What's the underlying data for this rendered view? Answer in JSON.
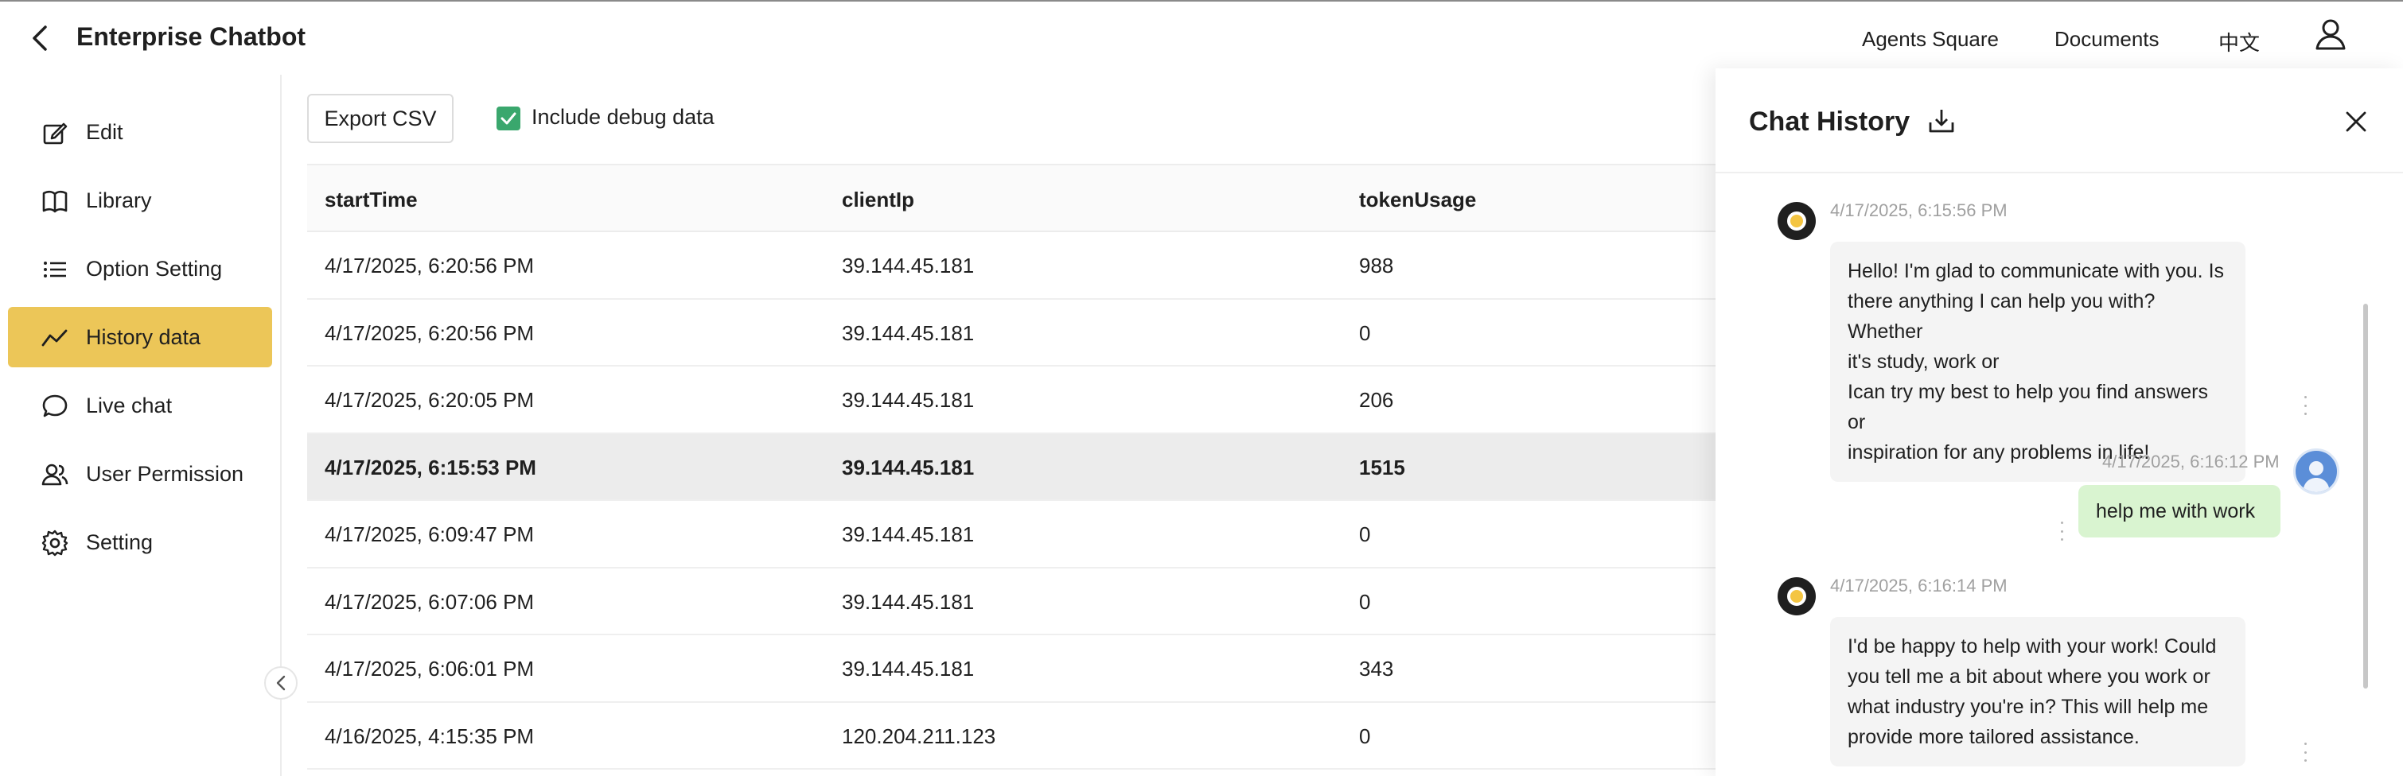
{
  "header": {
    "title": "Enterprise Chatbot",
    "nav": [
      "Agents Square",
      "Documents",
      "中文"
    ]
  },
  "sidebar": {
    "items": [
      {
        "label": "Edit",
        "icon": "edit-icon"
      },
      {
        "label": "Library",
        "icon": "book-icon"
      },
      {
        "label": "Option Setting",
        "icon": "list-icon"
      },
      {
        "label": "History data",
        "icon": "trend-icon",
        "active": true
      },
      {
        "label": "Live chat",
        "icon": "chat-icon"
      },
      {
        "label": "User Permission",
        "icon": "users-icon"
      },
      {
        "label": "Setting",
        "icon": "gear-icon"
      }
    ]
  },
  "toolbar": {
    "export_label": "Export CSV",
    "debug_label": "Include debug data",
    "debug_checked": true
  },
  "table": {
    "columns": [
      "startTime",
      "clientIp",
      "tokenUsage"
    ],
    "rows": [
      [
        "4/17/2025, 6:20:56 PM",
        "39.144.45.181",
        "988"
      ],
      [
        "4/17/2025, 6:20:56 PM",
        "39.144.45.181",
        "0"
      ],
      [
        "4/17/2025, 6:20:05 PM",
        "39.144.45.181",
        "206"
      ],
      [
        "4/17/2025, 6:15:53 PM",
        "39.144.45.181",
        "1515"
      ],
      [
        "4/17/2025, 6:09:47 PM",
        "39.144.45.181",
        "0"
      ],
      [
        "4/17/2025, 6:07:06 PM",
        "39.144.45.181",
        "0"
      ],
      [
        "4/17/2025, 6:06:01 PM",
        "39.144.45.181",
        "343"
      ],
      [
        "4/16/2025, 4:15:35 PM",
        "120.204.211.123",
        "0"
      ]
    ],
    "selected_row": 3
  },
  "drawer": {
    "title": "Chat History",
    "messages": [
      {
        "role": "bot",
        "time": "4/17/2025, 6:15:56 PM",
        "lines": [
          "Hello! I'm glad to communicate with you. Is",
          "there anything I can help you with? Whether",
          "it's study, work or",
          "Ican try my best to help you find answers or",
          "inspiration for any problems in life!"
        ]
      },
      {
        "role": "user",
        "time": "4/17/2025, 6:16:12 PM",
        "lines": [
          "help me with work"
        ]
      },
      {
        "role": "bot",
        "time": "4/17/2025, 6:16:14 PM",
        "lines": [
          "I'd be happy to help with your work! Could",
          "you tell me a bit about where you work or",
          "what industry you're in? This will help me",
          "provide more tailored assistance."
        ]
      }
    ]
  },
  "colors": {
    "active_nav": "#ecc658",
    "checkbox": "#3aa76d",
    "user_bubble": "#d9f4d0",
    "bot_bubble": "#f4f4f4"
  }
}
